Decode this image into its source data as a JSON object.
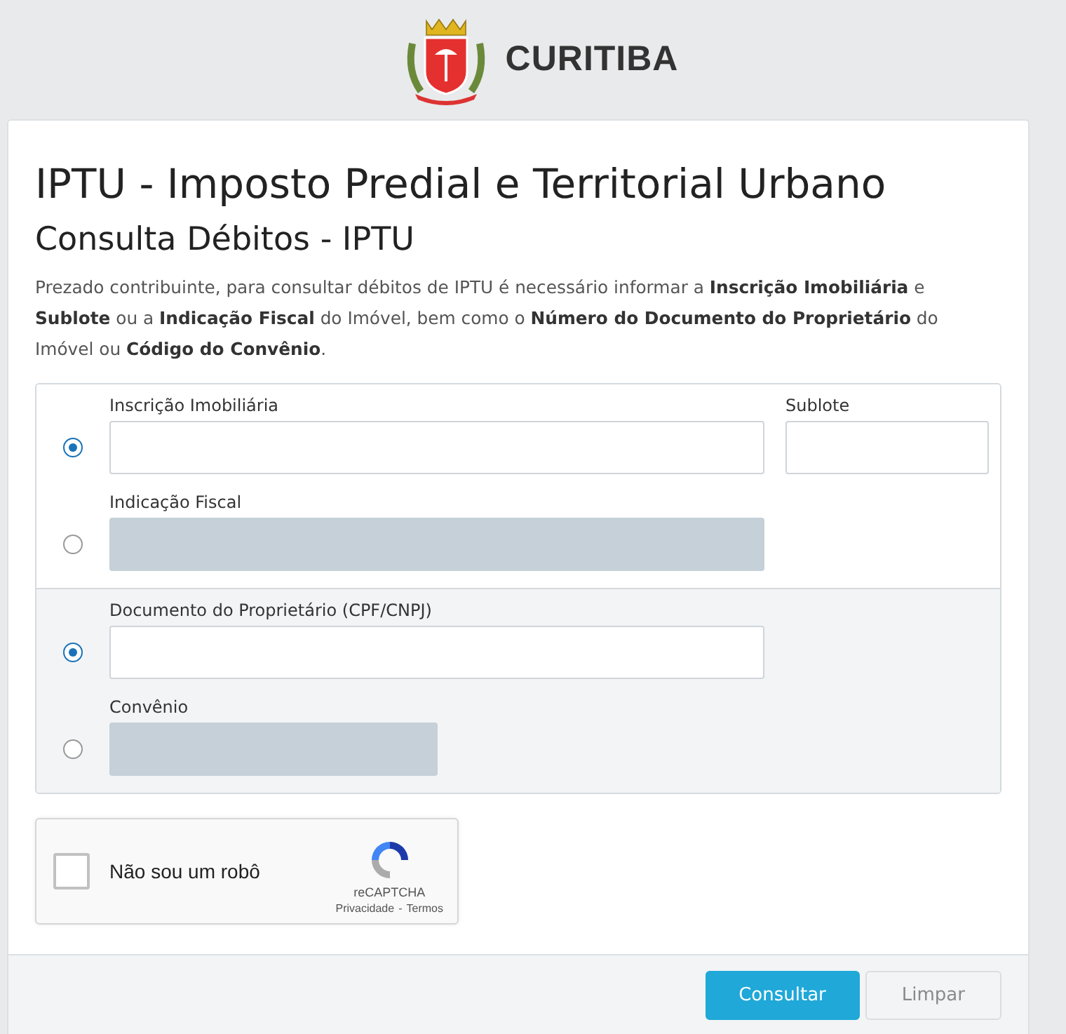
{
  "header": {
    "logo_text": "CURITIBA"
  },
  "page": {
    "title": "IPTU - Imposto Predial e Territorial Urbano",
    "subtitle": "Consulta Débitos - IPTU",
    "intro": "Prezado contribuinte, para consultar débitos de IPTU é necessário informar a **Inscrição Imobiliária** e **Sublote** ou a **Indicação Fiscal** do Imóvel, bem como o **Número do Documento do Proprietário** do Imóvel ou **Código do Convênio**."
  },
  "groups": [
    {
      "options": [
        {
          "selected": true,
          "fields": [
            {
              "label": "Inscrição Imobiliária",
              "kind": "wide",
              "disabled": false
            },
            {
              "label": "Sublote",
              "kind": "short",
              "disabled": false
            }
          ]
        },
        {
          "selected": false,
          "fields": [
            {
              "label": "Indicação Fiscal",
              "kind": "wide",
              "disabled": true
            }
          ]
        }
      ]
    },
    {
      "options": [
        {
          "selected": true,
          "fields": [
            {
              "label": "Documento do Proprietário (CPF/CNPJ)",
              "kind": "wide",
              "disabled": false
            }
          ]
        },
        {
          "selected": false,
          "fields": [
            {
              "label": "Convênio",
              "kind": "medium",
              "disabled": true
            }
          ]
        }
      ]
    }
  ],
  "captcha": {
    "label": "Não sou um robô",
    "checked": false,
    "brand": "reCAPTCHA",
    "privacy": "Privacidade",
    "separator": "-",
    "terms": "Termos"
  },
  "buttons": [
    {
      "label": "Consultar",
      "kind": "primary",
      "disabled": false
    },
    {
      "label": "Limpar",
      "kind": "secondary",
      "disabled": true
    }
  ]
}
